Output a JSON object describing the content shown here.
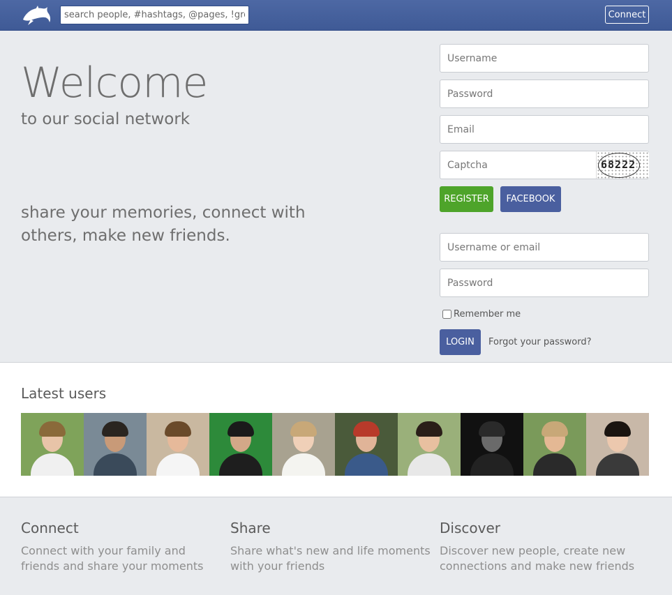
{
  "topbar": {
    "search_placeholder": "search people, #hashtags, @pages, !groups",
    "connect_label": "Connect"
  },
  "hero": {
    "title": "Welcome",
    "subtitle": "to our social network",
    "tagline": "share your memories, connect with others, make new friends."
  },
  "register": {
    "username_placeholder": "Username",
    "password_placeholder": "Password",
    "email_placeholder": "Email",
    "captcha_placeholder": "Captcha",
    "captcha_code": "68222",
    "register_label": "REGISTER",
    "facebook_label": "FACEBOOK"
  },
  "login": {
    "username_placeholder": "Username or email",
    "password_placeholder": "Password",
    "remember_label": "Remember me",
    "login_label": "LOGIN",
    "forgot_label": "Forgot your password?"
  },
  "latest_users": {
    "title": "Latest users",
    "users": [
      {
        "bg": "#7fa35a",
        "skin": "#e8c4a8",
        "hair": "#8a6a3a",
        "shirt": "#f0f0f0"
      },
      {
        "bg": "#7a8a96",
        "skin": "#c89a78",
        "hair": "#2a2520",
        "shirt": "#3a4a5a"
      },
      {
        "bg": "#c9b8a0",
        "skin": "#e6b99a",
        "hair": "#6a4a2a",
        "shirt": "#f5f5f5"
      },
      {
        "bg": "#2d8a3a",
        "skin": "#d2a888",
        "hair": "#1a1a1a",
        "shirt": "#1e1e1e"
      },
      {
        "bg": "#a8a290",
        "skin": "#f0d0b8",
        "hair": "#c8a878",
        "shirt": "#f4f4f0"
      },
      {
        "bg": "#4a5a3a",
        "skin": "#e0b498",
        "hair": "#b83a2a",
        "shirt": "#3a5a8a"
      },
      {
        "bg": "#9ab07a",
        "skin": "#e8c0a0",
        "hair": "#2a1e18",
        "shirt": "#e8e8e8"
      },
      {
        "bg": "#111111",
        "skin": "#6a6a6a",
        "hair": "#2a2a2a",
        "shirt": "#222222"
      },
      {
        "bg": "#7a9a5a",
        "skin": "#e4b894",
        "hair": "#c8a878",
        "shirt": "#2a2a2a"
      },
      {
        "bg": "#c8b8a8",
        "skin": "#ecc8ae",
        "hair": "#1a1410",
        "shirt": "#3a3a3a"
      }
    ]
  },
  "features": [
    {
      "title": "Connect",
      "text": "Connect with your family and friends and share your moments"
    },
    {
      "title": "Share",
      "text": "Share what's new and life moments with your friends"
    },
    {
      "title": "Discover",
      "text": "Discover new people, create new connections and make new friends"
    }
  ]
}
